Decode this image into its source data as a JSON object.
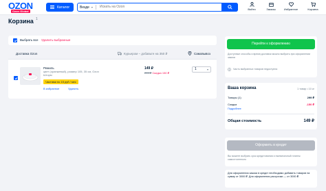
{
  "header": {
    "logo": "OZON",
    "logo_sub": "Ozon Global",
    "catalog_label": "Каталог",
    "search_scope": "Везде",
    "search_placeholder": "Искать на Ozon",
    "nav": [
      {
        "label": "Войти",
        "icon": "user-icon"
      },
      {
        "label": "Заказы",
        "icon": "box-icon"
      },
      {
        "label": "Избранное",
        "icon": "heart-icon"
      },
      {
        "label": "Корзина",
        "icon": "cart-icon"
      }
    ]
  },
  "page": {
    "title": "Корзина",
    "title_count": "1"
  },
  "select_bar": {
    "select_all": "Выбрать все",
    "delete_selected": "Удалить выбранные"
  },
  "delivery": {
    "label": "Доставка Ozon",
    "courier": "Курьером – добавьте на 350 ₽",
    "pickup": "Самовывоз"
  },
  "product": {
    "name": "Режиль",
    "description": "цвет (оранжевый), размер 105, 35 см, Ozon Шторм",
    "installment": "Частями по 15 руб / мес",
    "favorite": "В избранное",
    "remove": "Удалить",
    "price": "149 ₽",
    "old_price": "299 ₽",
    "discount": "Скидка 150 ₽",
    "quantity": "1"
  },
  "checkout": {
    "button": "Перейти к оформлению",
    "note": "Доступные способы и время доставки можно выбрать при оформлении заказа",
    "hint": "Часть выбранных товаров недоступна"
  },
  "summary": {
    "title": "Ваша корзина",
    "meta": "1 товар • 10 кг",
    "goods_label": "Товары (1)",
    "goods_value": "299 ₽",
    "discount_label": "Скидка",
    "discount_value": "-150 ₽",
    "details_link": "Подробнее",
    "total_label": "Общая стоимость",
    "total_value": "149 ₽"
  },
  "credit": {
    "button": "Оформить в кредит",
    "note": "Вы можете выбрать срок кредитования и ежемесячный платеж самостоятельно",
    "footer": "Для оформления заказа в кредит необходимо добавить товаров на сумму от 3000 ₽. Для оформления рассрочки — от 3000 ₽."
  },
  "colors": {
    "brand_blue": "#005bff",
    "green": "#10c44c",
    "accent_red": "#f91155",
    "badge_yellow": "#ffd30d"
  }
}
